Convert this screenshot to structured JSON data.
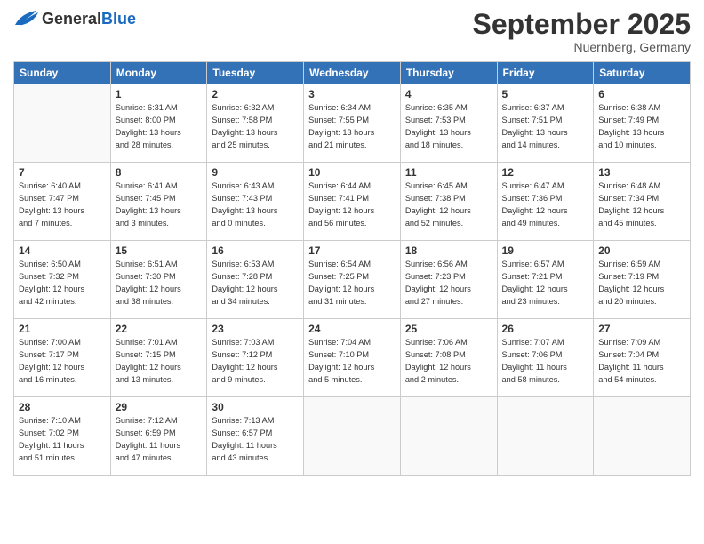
{
  "header": {
    "logo_general": "General",
    "logo_blue": "Blue",
    "month_title": "September 2025",
    "location": "Nuernberg, Germany"
  },
  "days_of_week": [
    "Sunday",
    "Monday",
    "Tuesday",
    "Wednesday",
    "Thursday",
    "Friday",
    "Saturday"
  ],
  "weeks": [
    [
      {
        "day": "",
        "info": []
      },
      {
        "day": "1",
        "info": [
          "Sunrise: 6:31 AM",
          "Sunset: 8:00 PM",
          "Daylight: 13 hours",
          "and 28 minutes."
        ]
      },
      {
        "day": "2",
        "info": [
          "Sunrise: 6:32 AM",
          "Sunset: 7:58 PM",
          "Daylight: 13 hours",
          "and 25 minutes."
        ]
      },
      {
        "day": "3",
        "info": [
          "Sunrise: 6:34 AM",
          "Sunset: 7:55 PM",
          "Daylight: 13 hours",
          "and 21 minutes."
        ]
      },
      {
        "day": "4",
        "info": [
          "Sunrise: 6:35 AM",
          "Sunset: 7:53 PM",
          "Daylight: 13 hours",
          "and 18 minutes."
        ]
      },
      {
        "day": "5",
        "info": [
          "Sunrise: 6:37 AM",
          "Sunset: 7:51 PM",
          "Daylight: 13 hours",
          "and 14 minutes."
        ]
      },
      {
        "day": "6",
        "info": [
          "Sunrise: 6:38 AM",
          "Sunset: 7:49 PM",
          "Daylight: 13 hours",
          "and 10 minutes."
        ]
      }
    ],
    [
      {
        "day": "7",
        "info": [
          "Sunrise: 6:40 AM",
          "Sunset: 7:47 PM",
          "Daylight: 13 hours",
          "and 7 minutes."
        ]
      },
      {
        "day": "8",
        "info": [
          "Sunrise: 6:41 AM",
          "Sunset: 7:45 PM",
          "Daylight: 13 hours",
          "and 3 minutes."
        ]
      },
      {
        "day": "9",
        "info": [
          "Sunrise: 6:43 AM",
          "Sunset: 7:43 PM",
          "Daylight: 13 hours",
          "and 0 minutes."
        ]
      },
      {
        "day": "10",
        "info": [
          "Sunrise: 6:44 AM",
          "Sunset: 7:41 PM",
          "Daylight: 12 hours",
          "and 56 minutes."
        ]
      },
      {
        "day": "11",
        "info": [
          "Sunrise: 6:45 AM",
          "Sunset: 7:38 PM",
          "Daylight: 12 hours",
          "and 52 minutes."
        ]
      },
      {
        "day": "12",
        "info": [
          "Sunrise: 6:47 AM",
          "Sunset: 7:36 PM",
          "Daylight: 12 hours",
          "and 49 minutes."
        ]
      },
      {
        "day": "13",
        "info": [
          "Sunrise: 6:48 AM",
          "Sunset: 7:34 PM",
          "Daylight: 12 hours",
          "and 45 minutes."
        ]
      }
    ],
    [
      {
        "day": "14",
        "info": [
          "Sunrise: 6:50 AM",
          "Sunset: 7:32 PM",
          "Daylight: 12 hours",
          "and 42 minutes."
        ]
      },
      {
        "day": "15",
        "info": [
          "Sunrise: 6:51 AM",
          "Sunset: 7:30 PM",
          "Daylight: 12 hours",
          "and 38 minutes."
        ]
      },
      {
        "day": "16",
        "info": [
          "Sunrise: 6:53 AM",
          "Sunset: 7:28 PM",
          "Daylight: 12 hours",
          "and 34 minutes."
        ]
      },
      {
        "day": "17",
        "info": [
          "Sunrise: 6:54 AM",
          "Sunset: 7:25 PM",
          "Daylight: 12 hours",
          "and 31 minutes."
        ]
      },
      {
        "day": "18",
        "info": [
          "Sunrise: 6:56 AM",
          "Sunset: 7:23 PM",
          "Daylight: 12 hours",
          "and 27 minutes."
        ]
      },
      {
        "day": "19",
        "info": [
          "Sunrise: 6:57 AM",
          "Sunset: 7:21 PM",
          "Daylight: 12 hours",
          "and 23 minutes."
        ]
      },
      {
        "day": "20",
        "info": [
          "Sunrise: 6:59 AM",
          "Sunset: 7:19 PM",
          "Daylight: 12 hours",
          "and 20 minutes."
        ]
      }
    ],
    [
      {
        "day": "21",
        "info": [
          "Sunrise: 7:00 AM",
          "Sunset: 7:17 PM",
          "Daylight: 12 hours",
          "and 16 minutes."
        ]
      },
      {
        "day": "22",
        "info": [
          "Sunrise: 7:01 AM",
          "Sunset: 7:15 PM",
          "Daylight: 12 hours",
          "and 13 minutes."
        ]
      },
      {
        "day": "23",
        "info": [
          "Sunrise: 7:03 AM",
          "Sunset: 7:12 PM",
          "Daylight: 12 hours",
          "and 9 minutes."
        ]
      },
      {
        "day": "24",
        "info": [
          "Sunrise: 7:04 AM",
          "Sunset: 7:10 PM",
          "Daylight: 12 hours",
          "and 5 minutes."
        ]
      },
      {
        "day": "25",
        "info": [
          "Sunrise: 7:06 AM",
          "Sunset: 7:08 PM",
          "Daylight: 12 hours",
          "and 2 minutes."
        ]
      },
      {
        "day": "26",
        "info": [
          "Sunrise: 7:07 AM",
          "Sunset: 7:06 PM",
          "Daylight: 11 hours",
          "and 58 minutes."
        ]
      },
      {
        "day": "27",
        "info": [
          "Sunrise: 7:09 AM",
          "Sunset: 7:04 PM",
          "Daylight: 11 hours",
          "and 54 minutes."
        ]
      }
    ],
    [
      {
        "day": "28",
        "info": [
          "Sunrise: 7:10 AM",
          "Sunset: 7:02 PM",
          "Daylight: 11 hours",
          "and 51 minutes."
        ]
      },
      {
        "day": "29",
        "info": [
          "Sunrise: 7:12 AM",
          "Sunset: 6:59 PM",
          "Daylight: 11 hours",
          "and 47 minutes."
        ]
      },
      {
        "day": "30",
        "info": [
          "Sunrise: 7:13 AM",
          "Sunset: 6:57 PM",
          "Daylight: 11 hours",
          "and 43 minutes."
        ]
      },
      {
        "day": "",
        "info": []
      },
      {
        "day": "",
        "info": []
      },
      {
        "day": "",
        "info": []
      },
      {
        "day": "",
        "info": []
      }
    ]
  ]
}
